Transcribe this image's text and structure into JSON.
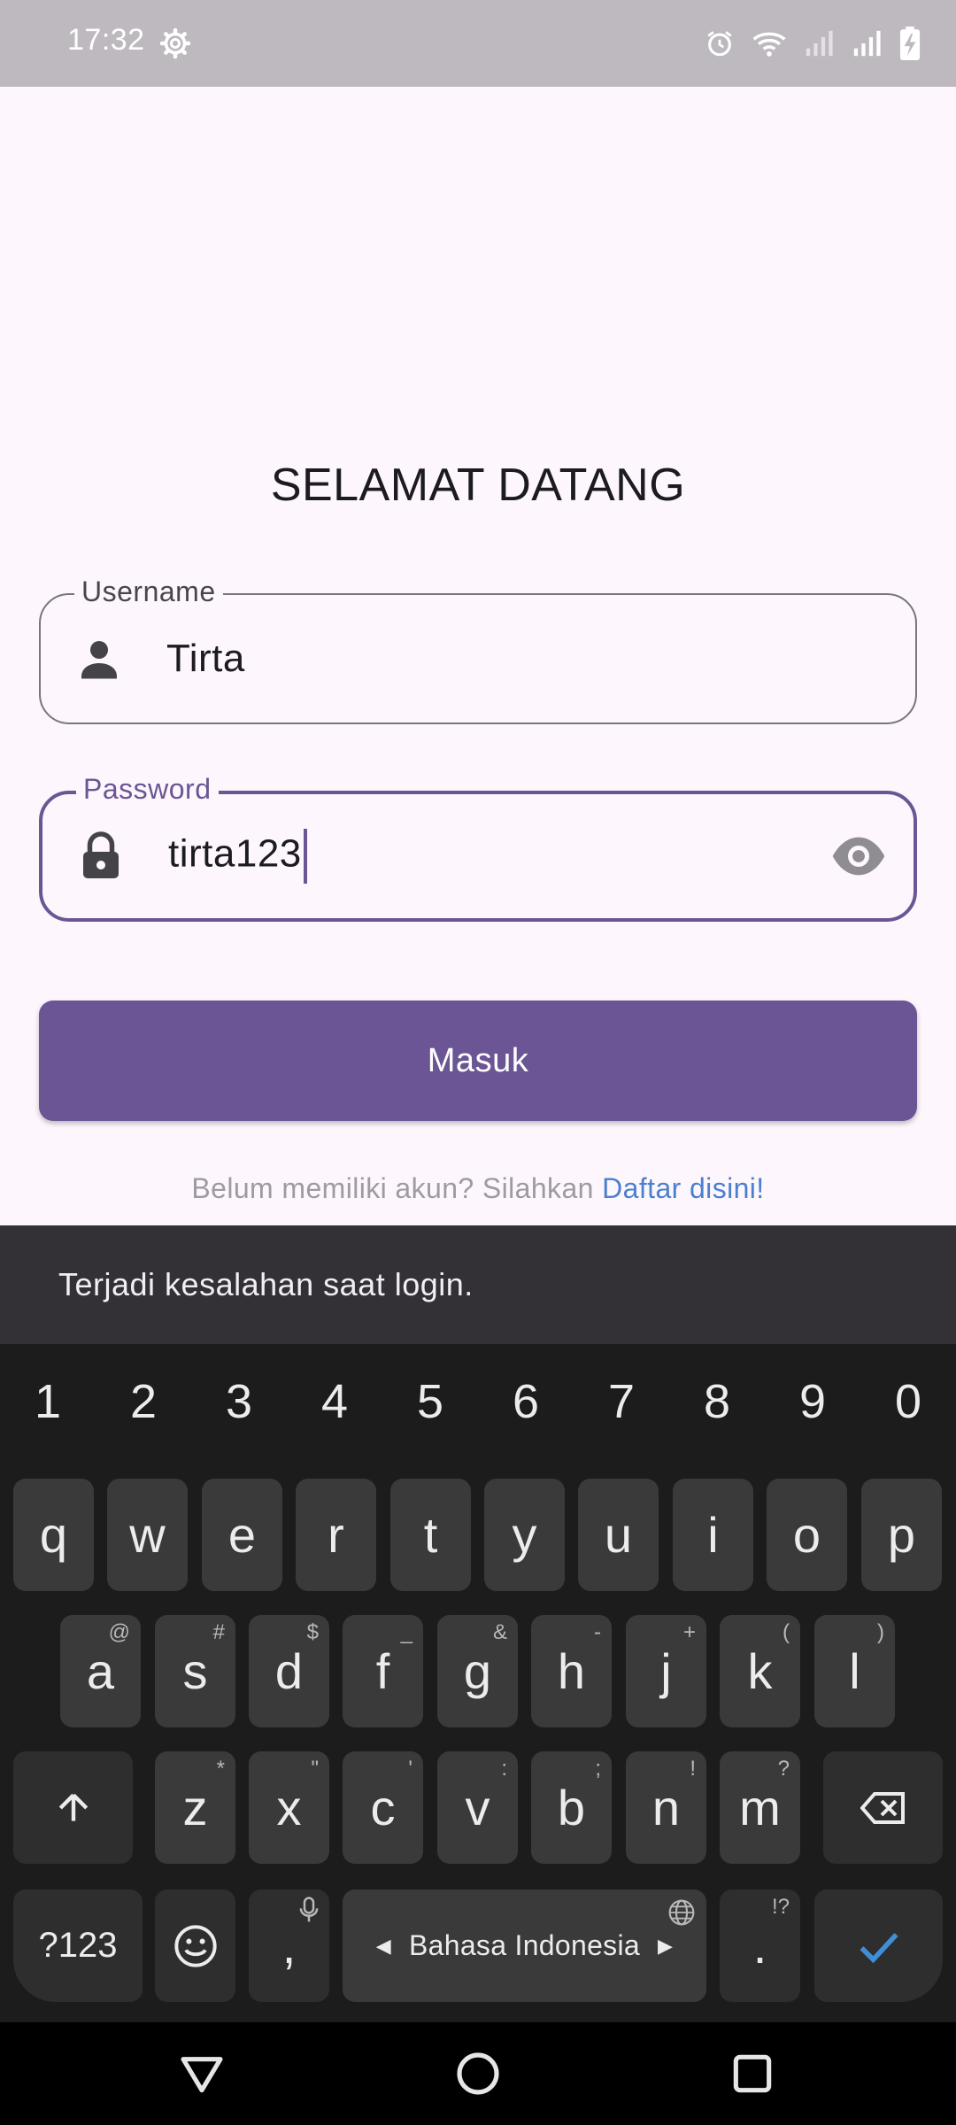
{
  "status_bar": {
    "time": "17:32",
    "icons": [
      "settings-icon",
      "alarm-icon",
      "wifi-icon",
      "signal-icon",
      "signal-icon",
      "battery-charging-icon"
    ]
  },
  "app": {
    "title": "SELAMAT DATANG",
    "username": {
      "label": "Username",
      "value": "Tirta",
      "icon": "person-icon"
    },
    "password": {
      "label": "Password",
      "value": "tirta123",
      "icon": "lock-icon",
      "toggle_icon": "eye-icon"
    },
    "login_button": "Masuk",
    "register_prompt": "Belum memiliki akun? Silahkan",
    "register_link": "Daftar disini!",
    "accent_color": "#6b5594",
    "link_color": "#4b7fd0"
  },
  "snackbar": {
    "message": "Terjadi kesalahan saat login."
  },
  "keyboard": {
    "numbers": [
      "1",
      "2",
      "3",
      "4",
      "5",
      "6",
      "7",
      "8",
      "9",
      "0"
    ],
    "row1": [
      {
        "key": "q"
      },
      {
        "key": "w"
      },
      {
        "key": "e"
      },
      {
        "key": "r"
      },
      {
        "key": "t"
      },
      {
        "key": "y"
      },
      {
        "key": "u"
      },
      {
        "key": "i"
      },
      {
        "key": "o"
      },
      {
        "key": "p"
      }
    ],
    "row2": [
      {
        "key": "a",
        "hint": "@"
      },
      {
        "key": "s",
        "hint": "#"
      },
      {
        "key": "d",
        "hint": "$"
      },
      {
        "key": "f",
        "hint": "_"
      },
      {
        "key": "g",
        "hint": "&"
      },
      {
        "key": "h",
        "hint": "-"
      },
      {
        "key": "j",
        "hint": "+"
      },
      {
        "key": "k",
        "hint": "("
      },
      {
        "key": "l",
        "hint": ")"
      }
    ],
    "row3": [
      {
        "key": "z",
        "hint": "*"
      },
      {
        "key": "x",
        "hint": "\""
      },
      {
        "key": "c",
        "hint": "'"
      },
      {
        "key": "v",
        "hint": ":"
      },
      {
        "key": "b",
        "hint": ";"
      },
      {
        "key": "n",
        "hint": "!"
      },
      {
        "key": "m",
        "hint": "?"
      }
    ],
    "symbols_key": "?123",
    "comma_key": ",",
    "space_label": "Bahasa Indonesia",
    "period_key": ".",
    "period_hint": "!?"
  },
  "nav_bar": {
    "buttons": [
      "back-icon",
      "home-icon",
      "recents-icon"
    ]
  }
}
